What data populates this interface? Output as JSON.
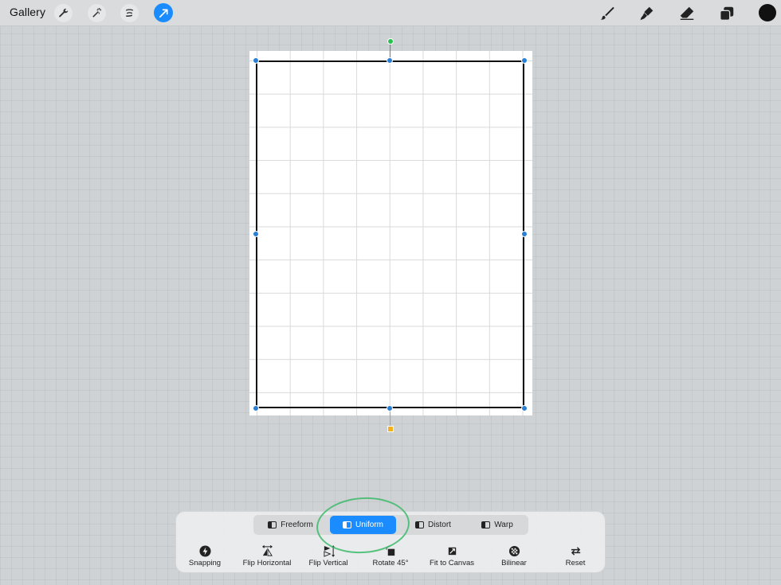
{
  "topbar": {
    "gallery_label": "Gallery",
    "left_tools": [
      "wrench-icon",
      "magic-wand-icon",
      "selection-icon",
      "transform-arrow-icon"
    ],
    "right_tools": [
      "brush-icon",
      "smudge-icon",
      "eraser-icon",
      "layers-icon"
    ],
    "current_color": "#111111"
  },
  "canvas": {
    "background": "#ffffff",
    "grid_color": "#d9d9d9"
  },
  "transform_modes": {
    "options": [
      "Freeform",
      "Uniform",
      "Distort",
      "Warp"
    ],
    "selected": "Uniform"
  },
  "actions": {
    "snapping": "Snapping",
    "flip_horizontal": "Flip Horizontal",
    "flip_vertical": "Flip Vertical",
    "rotate_45": "Rotate 45°",
    "fit_to_canvas": "Fit to Canvas",
    "bilinear": "Bilinear",
    "reset": "Reset"
  },
  "colors": {
    "accent": "#1a8cff",
    "rotation_handle": "#27c24d",
    "pivot_handle": "#f5b020",
    "highlight_circle": "#3dbb6b"
  }
}
